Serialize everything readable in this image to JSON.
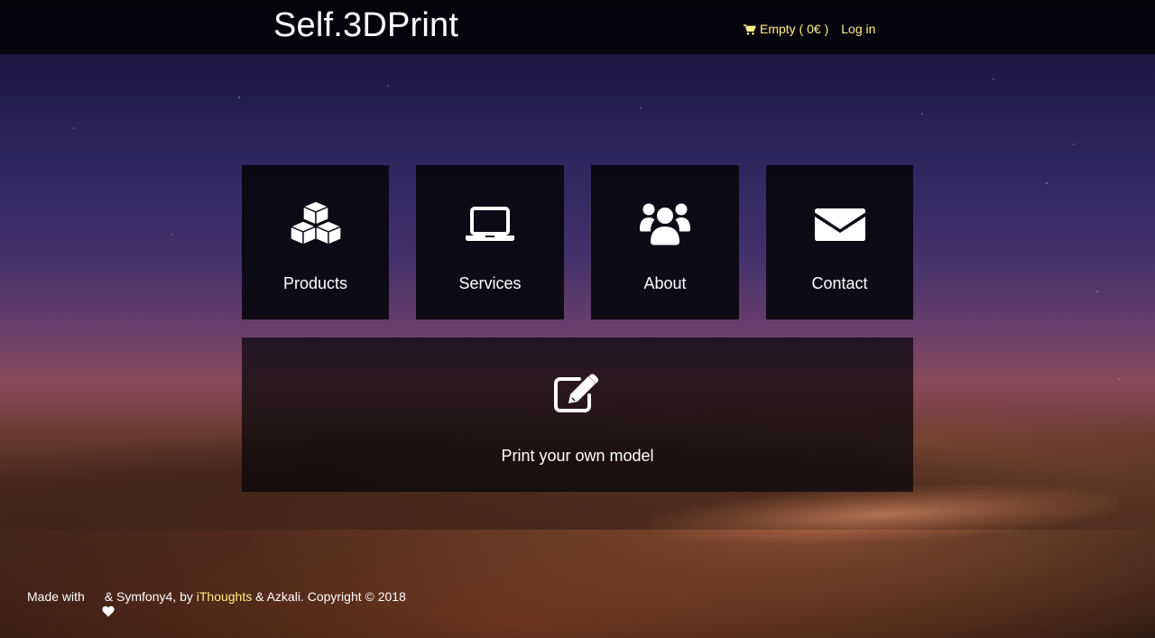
{
  "header": {
    "brand": "Self.3DPrint",
    "cart": {
      "icon": "shopping-cart-icon",
      "label": "Empty ( 0€ )"
    },
    "login_label": "Log in",
    "link_color": "#ffef8a"
  },
  "tiles": [
    {
      "label": "Products",
      "icon": "cubes-icon"
    },
    {
      "label": "Services",
      "icon": "laptop-icon"
    },
    {
      "label": "About",
      "icon": "users-icon"
    },
    {
      "label": "Contact",
      "icon": "envelope-icon"
    }
  ],
  "wide_tile": {
    "label": "Print your own model",
    "icon": "edit-icon"
  },
  "footer": {
    "made_with": "Made with",
    "heart_icon": "heart-icon",
    "after_heart": "& Symfony4, by",
    "ithoughts_link": "iThoughts",
    "after_link": "& Azkali. Copyright © 2018"
  }
}
